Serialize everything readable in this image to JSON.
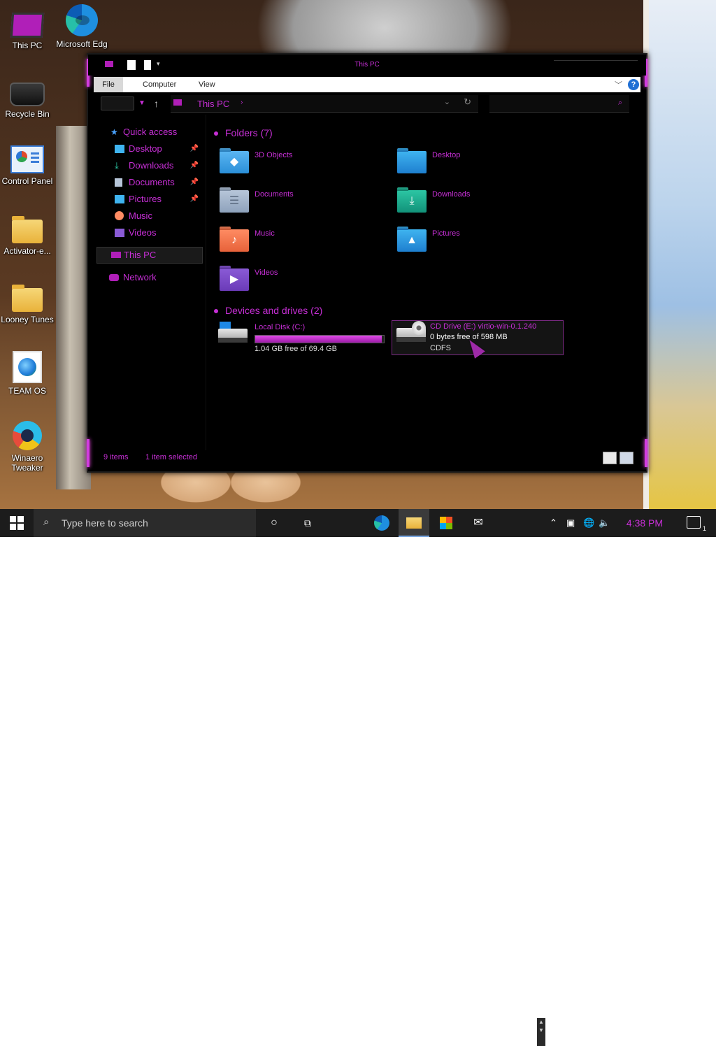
{
  "desktop": {
    "icons": [
      {
        "label": "This PC",
        "icon": "this-pc-icon"
      },
      {
        "label": "Microsoft Edg",
        "icon": "edge-icon"
      },
      {
        "label": "Recycle Bin",
        "icon": "recycle-bin-icon"
      },
      {
        "label": "Control Panel",
        "icon": "control-panel-icon"
      },
      {
        "label": "Activator-e...",
        "icon": "folder-icon"
      },
      {
        "label": "Looney Tunes",
        "icon": "folder-icon"
      },
      {
        "label": "TEAM OS",
        "icon": "team-os-icon"
      },
      {
        "label": "Winaero Tweaker",
        "icon": "winaero-icon"
      }
    ]
  },
  "window": {
    "title": "This PC",
    "accent": "#c72fd6",
    "ribbon_tabs": [
      "File",
      "Computer",
      "View"
    ],
    "help": "?",
    "address": {
      "crumb": "This PC"
    },
    "nav": {
      "quick_access": "Quick access",
      "items": [
        {
          "label": "Desktop",
          "pinned": true
        },
        {
          "label": "Downloads",
          "pinned": true
        },
        {
          "label": "Documents",
          "pinned": true
        },
        {
          "label": "Pictures",
          "pinned": true
        },
        {
          "label": "Music",
          "pinned": false
        },
        {
          "label": "Videos",
          "pinned": false
        }
      ],
      "this_pc": "This PC",
      "network": "Network"
    },
    "folders_header": "Folders (7)",
    "folders": [
      {
        "label": "3D Objects",
        "icon": "3d-objects-icon"
      },
      {
        "label": "Desktop",
        "icon": "desktop-folder-icon"
      },
      {
        "label": "Documents",
        "icon": "documents-folder-icon"
      },
      {
        "label": "Downloads",
        "icon": "downloads-folder-icon"
      },
      {
        "label": "Music",
        "icon": "music-folder-icon"
      },
      {
        "label": "Pictures",
        "icon": "pictures-folder-icon"
      },
      {
        "label": "Videos",
        "icon": "videos-folder-icon"
      }
    ],
    "drives_header": "Devices and drives (2)",
    "drives": [
      {
        "name": "Local Disk (C:)",
        "free": "1.04 GB free of 69.4 GB",
        "used_fraction": 0.985
      },
      {
        "name": "CD Drive (E:) virtio-win-0.1.240",
        "free": "0 bytes free of 598 MB",
        "fs": "CDFS"
      }
    ],
    "status": {
      "items": "9 items",
      "selected": "1 item selected"
    }
  },
  "taskbar": {
    "search_placeholder": "Type here to search",
    "clock": "4:38 PM"
  }
}
